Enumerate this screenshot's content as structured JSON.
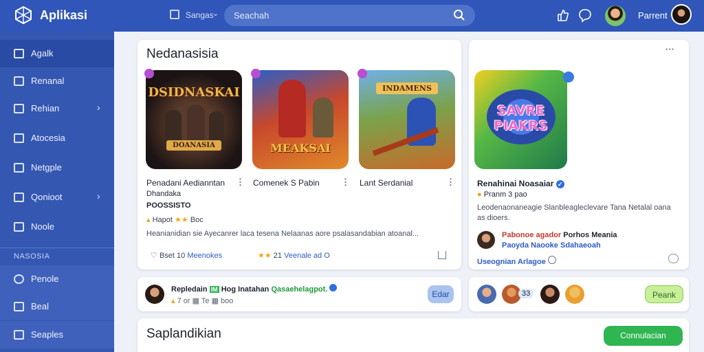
{
  "header": {
    "app_title": "Aplikasi",
    "breadcrumb": "Sangas",
    "search_placeholder": "Seachah",
    "profile_name": "Parrent"
  },
  "sidebar": {
    "items": [
      {
        "label": "Agalk",
        "icon": "grid-icon"
      },
      {
        "label": "Renanal",
        "icon": "document-icon"
      },
      {
        "label": "Rehian",
        "icon": "video-icon"
      },
      {
        "label": "Atocesia",
        "icon": "folder-icon"
      },
      {
        "label": "Netgple",
        "icon": "square-icon"
      },
      {
        "label": "Qonioot",
        "icon": "box-icon"
      },
      {
        "label": "Noole",
        "icon": "grid-icon"
      }
    ],
    "section_label": "NASOSIA",
    "lower_items": [
      {
        "label": "Penole",
        "icon": "target-icon"
      },
      {
        "label": "Beal",
        "icon": "home-icon"
      },
      {
        "label": "Seaples",
        "icon": "document-icon"
      }
    ]
  },
  "featured": {
    "title": "Nedanasisia",
    "games": [
      {
        "tile_text": "DSIDNASKAI",
        "tile_subtext": "DOANASIA",
        "name": "Penadani Aedianntan",
        "sub": "Dhandaka",
        "dev": "POOSSISTO"
      },
      {
        "tile_text": "MEAKSAI",
        "name": "Comenek S Pabin"
      },
      {
        "tile_text": "INDAMENS",
        "name": "Lant Serdanial"
      }
    ],
    "rating_line": "Hapot",
    "rating_suffix": "Boc",
    "description": "Heanianidian sie Ayecanrer laca tesena Nelaanas aore psalasandabian atoanal...",
    "stats": {
      "likes": "Bset",
      "count": "10",
      "link": "Meenokes",
      "rating": "21",
      "link2": "Veenale ad O"
    }
  },
  "spotlight": {
    "tile_text": "SAVRE PIAKRS",
    "title": "Renahinai Noasaiar",
    "rating_label": "Pranm 3 pao",
    "description": "Leodenaonaneagie Slanbleagleclevare Tana Netalal oana as dioers.",
    "author_line1": "Pabonoe agador",
    "author_line1b": "Porhos Meania",
    "author_line2": "Paoyda Naooke Sdahaeoah",
    "footer_link": "Useognian Arlagoe"
  },
  "activity": {
    "user": "Repledain",
    "tag": "IM",
    "text": "Hog Inatahan",
    "highlight": "Qasaehelagpot.",
    "meta1": "7 or",
    "meta2": "Te",
    "meta3": "boo",
    "button": "Edar"
  },
  "friends": {
    "count": "33",
    "button": "Peank"
  },
  "bottom": {
    "title": "Saplandikian",
    "button": "Connulacian"
  },
  "colors": {
    "topbar": "#2f56b8",
    "sidebar": "#3457b2",
    "accent_green": "#2fb552",
    "link_blue": "#2f5bc6"
  }
}
